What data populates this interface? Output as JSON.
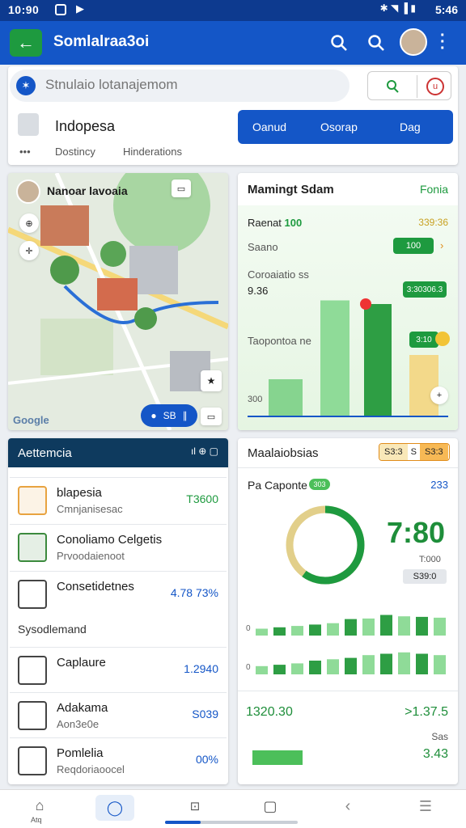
{
  "status": {
    "time": "10:90",
    "right": "5:46"
  },
  "appbar": {
    "title": "Somlalraa3oi"
  },
  "search": {
    "placeholder": "Stnulaio lotanajemom"
  },
  "location": {
    "title": "Indopesa",
    "sub1": "Dostincy",
    "sub2": "Hinderations",
    "segs": [
      "Oanud",
      "Osorap",
      "Dag"
    ]
  },
  "map": {
    "title": "Nanoar lavoaia",
    "brand": "Google",
    "nav": "SB"
  },
  "meeting": {
    "title": "Mamingt Sdam",
    "badge": "Fonia",
    "r1l": "Raenat",
    "r1v": "100",
    "r1r": "339:36",
    "r2l": "Saano",
    "r2v": "100",
    "r3l": "Coroaiatio  ss",
    "r3v": "9.36",
    "r3b": "3:30306.3",
    "r4l": "Taopontoa ne",
    "r4b": "3:10",
    "yl": "300",
    "chart_data": {
      "type": "bar",
      "values": [
        30,
        95,
        92,
        50
      ],
      "colors": [
        "#86d48f",
        "#8fdb98",
        "#2e9e44",
        "#f3d98a"
      ]
    }
  },
  "attendance": {
    "title": "Aettemcia",
    "items": [
      {
        "t1": "blapesia",
        "t2": "Cmnjanisesac",
        "v": "T3600",
        "c": "#e8a340"
      },
      {
        "t1": "Conoliamo Celgetis",
        "t2": "Prvoodaienoot",
        "v": "",
        "c": "#3b8a3d"
      },
      {
        "t1": "Consetidetnes",
        "t2": "",
        "v": "4.78 73%",
        "c": "#444"
      }
    ],
    "section": "Sysodlemand",
    "items2": [
      {
        "t1": "Caplaure",
        "t2": "",
        "v": "1.2940",
        "c": "#444"
      },
      {
        "t1": "Adakama",
        "t2": "Aon3e0e",
        "v": "S039",
        "c": "#444"
      },
      {
        "t1": "Pomlelia",
        "t2": "Reqdoriaoocel",
        "v": "00%",
        "c": "#444"
      }
    ]
  },
  "metrics": {
    "title": "Maalaiobsias",
    "tags": [
      "S3:3",
      "S",
      "S3:3"
    ],
    "sub": "Pa Caponte",
    "sublabel": "303",
    "count": "233",
    "big": "7:80",
    "bigsub": "T:000",
    "chip": "S39:0",
    "n1": "1320.30",
    "n2": ">1.37.5",
    "n3": "3.43",
    "lbl": "Sas",
    "chart_data": {
      "type": "bar",
      "donut": [
        0.6,
        0.4
      ],
      "row1": [
        0.25,
        0.3,
        0.35,
        0.4,
        0.45,
        0.6,
        0.62,
        0.75,
        0.7,
        0.68,
        0.65
      ],
      "row2": [
        0.3,
        0.35,
        0.4,
        0.5,
        0.55,
        0.6,
        0.7,
        0.75,
        0.8,
        0.75,
        0.7
      ]
    }
  },
  "nav": [
    "home-icon",
    "chat-icon",
    "slides-icon",
    "square-icon",
    "back-icon",
    "menu-icon"
  ],
  "navHome": "Atq"
}
